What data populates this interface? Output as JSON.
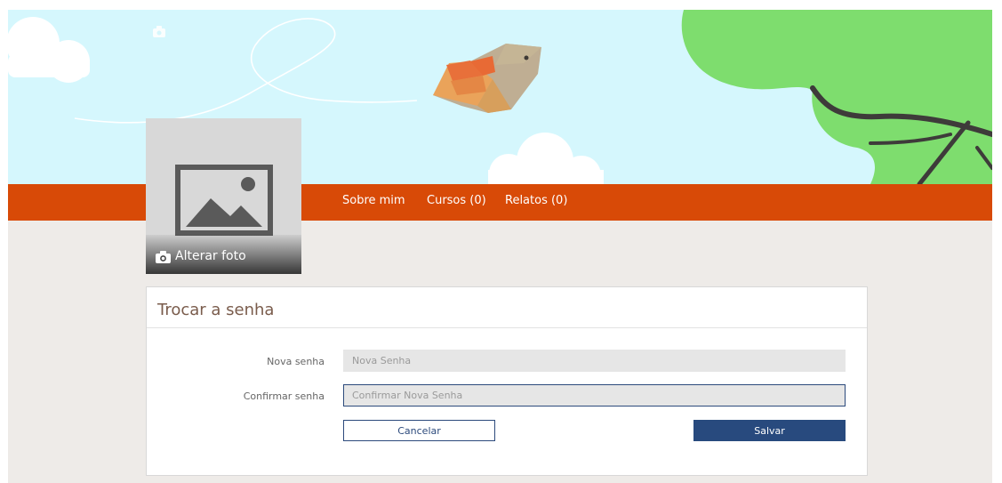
{
  "nav": {
    "items": [
      {
        "label": "Sobre mim"
      },
      {
        "label": "Cursos (0)"
      },
      {
        "label": "Relatos (0)"
      }
    ]
  },
  "profile": {
    "change_photo_label": "Alterar foto"
  },
  "password_form": {
    "title": "Trocar a senha",
    "new_password": {
      "label": "Nova senha",
      "placeholder": "Nova Senha",
      "value": ""
    },
    "confirm_password": {
      "label": "Confirmar senha",
      "placeholder": "Confirmar Nova Senha",
      "value": ""
    },
    "cancel_label": "Cancelar",
    "save_label": "Salvar"
  },
  "icons": {
    "camera": "camera-icon",
    "image_placeholder": "image-placeholder-icon"
  },
  "colors": {
    "banner_sky": "#d5f7fd",
    "nav_bar": "#d84a07",
    "tree": "#7edd6e",
    "primary_button": "#284a7e",
    "title_text": "#7a5c4c"
  }
}
